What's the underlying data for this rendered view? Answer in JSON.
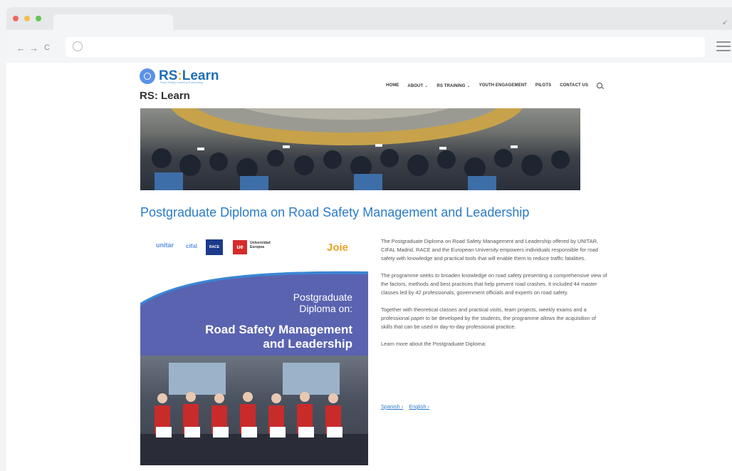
{
  "browser": {
    "colors": {
      "close": "#ed6a5e",
      "minimize": "#f5bf4f",
      "maximize": "#61c554"
    },
    "nav_icons": [
      "back-arrow-icon",
      "forward-arrow-icon",
      "reload-icon"
    ],
    "back": "←",
    "forward": "→",
    "reload": "C",
    "resize": "↙"
  },
  "site": {
    "logo_rs": "RS",
    "logo_colon": ":",
    "logo_learn": "Learn",
    "logo_tagline": "Road Safety Learning Partnership",
    "title": "RS: Learn"
  },
  "nav": {
    "items": [
      {
        "label": "HOME"
      },
      {
        "label": "ABOUT",
        "caret": "⌄"
      },
      {
        "label": "RS TRAINING",
        "caret": "⌄"
      },
      {
        "label": "YOUTH ENGAGEMENT"
      },
      {
        "label": "PILOTS"
      },
      {
        "label": "CONTACT US"
      }
    ]
  },
  "main": {
    "heading": "Postgraduate Diploma on Road Safety Management and Leadership",
    "poster": {
      "logos": {
        "unitar": "unitar",
        "cifal": "cifal",
        "race": "RACE",
        "ue_mark": "ue",
        "universidad": "Universidad",
        "europea": "Europea",
        "joie": "Joie"
      },
      "line1": "Postgraduate",
      "line2": "Diploma on:",
      "line3": "Road Safety Management",
      "line4": "and Leadership"
    },
    "paragraphs": [
      "The Postgraduate Diploma on Road Safety Management and Leadership offered by UNITAR, CIFAL Madrid, RACE and the European University empowers individuals responsible for road safety with knowledge and practical tools that will enable them to reduce traffic fatalities.",
      "The programme seeks to broaden knowledge on road safety presenting a comprehensive view of the factors, methods and best practices that help prevent road crashes. It included 44 master classes led by 42 professionals, government officials and experts on road safety.",
      "Together with theoretical classes and practical visits, team projects, weekly exams and a professional paper to be developed by the students, the programme allows the acquisition of skills that can be used in day-to-day professional practice.",
      "Learn more about the Postgraduate Diploma:"
    ],
    "links": [
      "Spanish ›",
      "English ›"
    ]
  }
}
